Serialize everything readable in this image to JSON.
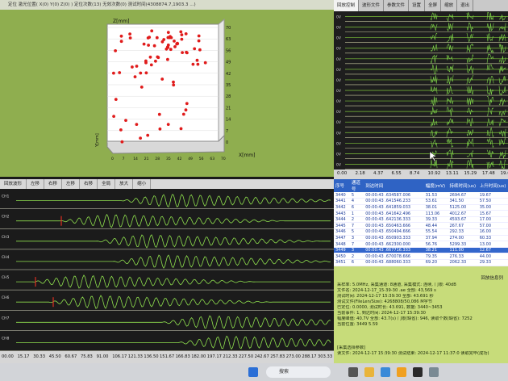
{
  "plot3d": {
    "title": "定位 激光位置(  X(0) Y(0) Z(0) )  定位次数(13) 无效次数(0)  测试时间(4308874.7,1903.3 ...)",
    "z_label": "Z[mm]",
    "x_label": "X[mm]",
    "y_label": "Y[mm]",
    "z_ticks": [
      "70",
      "63",
      "56",
      "49",
      "42",
      "35",
      "28",
      "21",
      "14",
      "7",
      "0"
    ],
    "x_ticks": [
      "0",
      "7",
      "14",
      "21",
      "28",
      "35",
      "42",
      "49",
      "56",
      "63",
      "70"
    ],
    "colors": {
      "bg": "#8fae4f",
      "point": "#e01b1b",
      "box": "#ffffff"
    }
  },
  "wave_tabs": {
    "items": [
      "回放控制",
      "波形文件",
      "参数文件",
      "设置",
      "全屏",
      "缩放",
      "退出"
    ],
    "channels": [
      "0V",
      "0V",
      "0V",
      "0V",
      "0V",
      "0V",
      "0V",
      "0V",
      "0V",
      "0V",
      "0V",
      "0V",
      "0V",
      "0V",
      "0V"
    ],
    "time_ticks": [
      "0.00",
      "2.18",
      "4.37",
      "6.55",
      "8.74",
      "10.92",
      "13.11",
      "15.29",
      "17.48",
      "19.66"
    ]
  },
  "bottom_wave": {
    "toolbar": [
      "回放波形",
      "左移",
      "右移",
      "左移",
      "右移",
      "全局",
      "放大",
      "缩小"
    ],
    "channels": [
      "CH1",
      "CH2",
      "CH3",
      "CH4",
      "CH5",
      "CH6",
      "CH7",
      "CH8"
    ],
    "time_ticks": [
      "00.00",
      "15.17",
      "30.33",
      "45.50",
      "60.67",
      "75.83",
      "91.00",
      "106.17",
      "121.33",
      "136.50",
      "151.67",
      "166.83",
      "182.00",
      "197.17",
      "212.33",
      "227.50",
      "242.67",
      "257.83",
      "273.00",
      "288.17",
      "303.33"
    ]
  },
  "event_table": {
    "columns": [
      "序号",
      "通道号",
      "到达时间",
      "幅度(mV)",
      "持续时间(us)",
      "上升时间(us)"
    ],
    "rows": [
      [
        "3440",
        "5",
        "00:00:43 .634587.006",
        "31.53",
        "2694.67",
        "19.67"
      ],
      [
        "3441",
        "4",
        "00:00:43 .641546.233",
        "53.61",
        "341.50",
        "57.50"
      ],
      [
        "3442",
        "6",
        "00:00:43 .641859.033",
        "38.01",
        "5125.00",
        "35.00"
      ],
      [
        "3443",
        "1",
        "00:00:43 .641642.496",
        "113.06",
        "4012.67",
        "15.67"
      ],
      [
        "3444",
        "2",
        "00:00:43 .642136.333",
        "39.33",
        "4593.67",
        "17.00"
      ],
      [
        "3445",
        "7",
        "00:00:43 .650463.666",
        "48.44",
        "267.67",
        "57.00"
      ],
      [
        "3446",
        "5",
        "00:00:43 .650494.666",
        "55.54",
        "292.33",
        "16.00"
      ],
      [
        "3447",
        "3",
        "00:00:43 .650903.333",
        "37.94",
        "274.00",
        "60.33"
      ],
      [
        "3448",
        "7",
        "00:00:43 .662300.000",
        "56.76",
        "5299.33",
        "13.00"
      ],
      [
        "3449",
        "3",
        "00:00:43 .667716.333",
        "38.21",
        "111.00",
        "12.67"
      ],
      [
        "3450",
        "2",
        "00:00:43 .670078.666",
        "79.35",
        "276.33",
        "44.00"
      ],
      [
        "3451",
        "6",
        "00:00:43 .688060.333",
        "69.20",
        "2062.33",
        "29.33"
      ],
      [
        "3452",
        "7",
        "00:00:43 .689502.033",
        "43.95",
        "55.33",
        "24.67"
      ],
      [
        "3453",
        "6",
        "00:00:43 .689979.000",
        "122.36",
        "264.00",
        "26.67"
      ]
    ],
    "selected_index": 9
  },
  "info_panel": {
    "header": "回放信息列",
    "lines": [
      "采样率: 5.0MHz,  采集通道: 8通道,  采集模式: 连续,  门限: 40dB",
      "文件名: 2024-12-17_15-39-30 .ae  全部: 43,569  s",
      "测试时间: 2024-12-17 15:39:30  全部: 43.691 秒",
      "测试文件(FileLen/Size): 4268808/50,086 M字节",
      "已定位: 0.0000,  测试时长: 43.691, 数据: 3440~3453",
      "当前事件: 1, 到达时间: 2024-12-17 15:39:30",
      "幅度峰值: 40.7V  全部: 43.7(s)  门限(缺省): 946,  读取个数(缺省): 7252",
      "当前位置: 3449  5.59"
    ],
    "footer": [
      "[采集选择参数]",
      "读文件: 2024-12-17 15:39:30    测试结束: 2024-12-17 11:37:0    读取完毕(成功)"
    ]
  },
  "taskbar": {
    "search_placeholder": "搜索"
  }
}
